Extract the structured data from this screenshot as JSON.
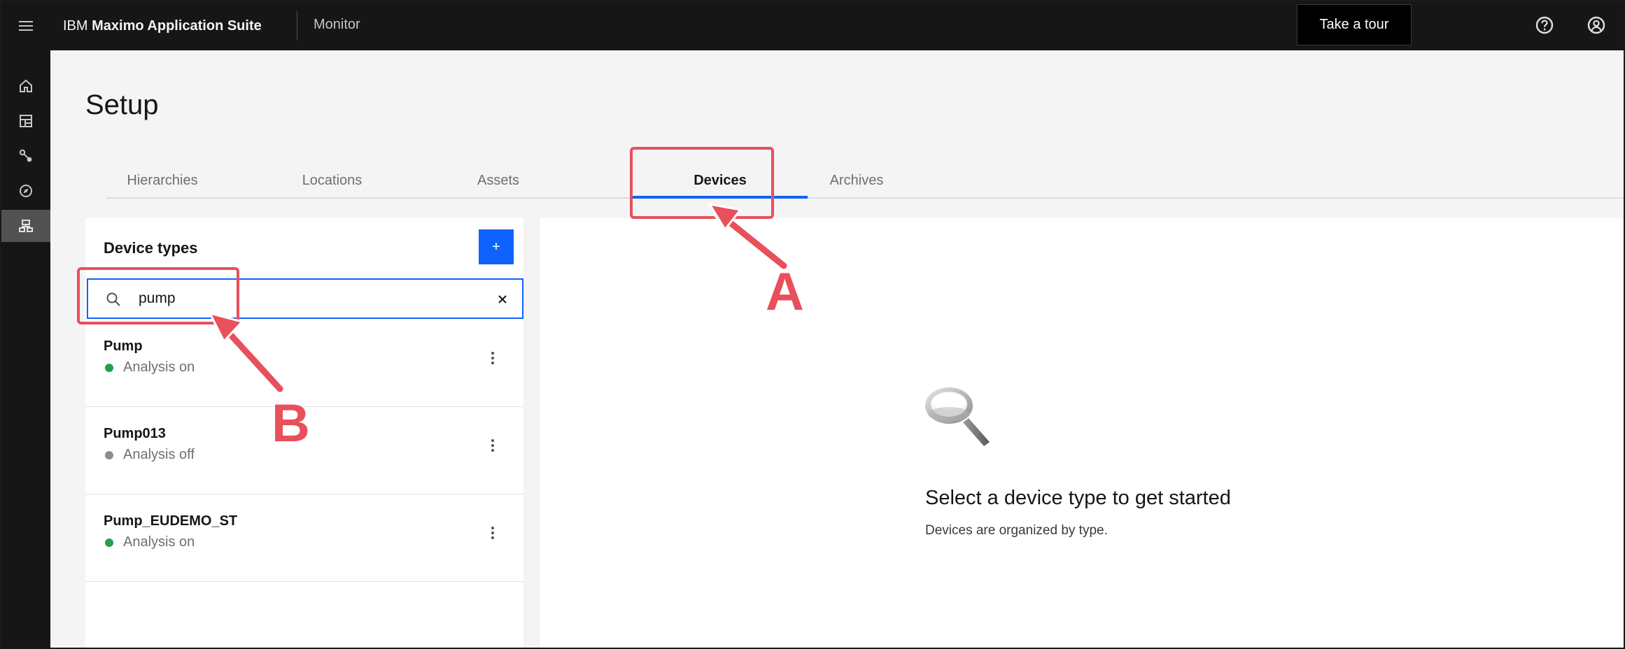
{
  "header": {
    "brand_prefix": "IBM",
    "brand_bold": "Maximo Application Suite",
    "app_name": "Monitor",
    "tour_label": "Take a tour",
    "icons": [
      "menu-icon",
      "help-icon",
      "user-icon"
    ]
  },
  "rail": {
    "items": [
      "home-icon",
      "dashboard-icon",
      "connections-icon",
      "explore-icon",
      "setup-icon"
    ],
    "active": "setup-icon"
  },
  "page": {
    "title": "Setup",
    "tabs": [
      {
        "label": "Hierarchies"
      },
      {
        "label": "Locations"
      },
      {
        "label": "Assets"
      },
      {
        "label": "Devices"
      },
      {
        "label": "Archives"
      }
    ],
    "active_tab": "Devices"
  },
  "device_types": {
    "title": "Device types",
    "add_label": "+",
    "search": {
      "value": "pump",
      "placeholder": ""
    },
    "items": [
      {
        "name": "Pump",
        "status": "Analysis on",
        "status_color": "#24a148"
      },
      {
        "name": "Pump013",
        "status": "Analysis off",
        "status_color": "#8d8d8d"
      },
      {
        "name": "Pump_EUDEMO_ST",
        "status": "Analysis on",
        "status_color": "#24a148"
      }
    ]
  },
  "empty_state": {
    "title": "Select a device type to get started",
    "subtitle": "Devices are organized by type.",
    "icon": "magnifier-icon"
  },
  "annotations": {
    "a": "A",
    "b": "B",
    "color": "#e8505b"
  },
  "colors": {
    "accent": "#0f62fe",
    "header_bg": "#161616",
    "page_bg": "#f4f4f4"
  }
}
